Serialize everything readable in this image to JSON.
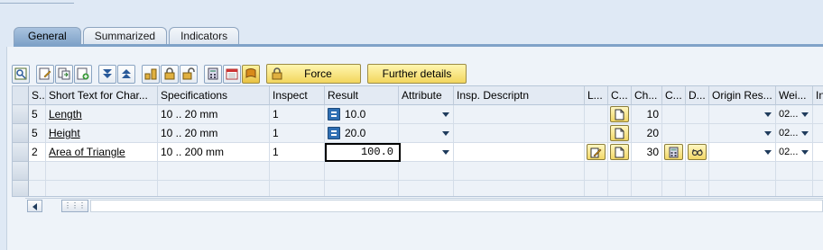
{
  "tabs": [
    {
      "label": "General",
      "active": true
    },
    {
      "label": "Summarized",
      "active": false
    },
    {
      "label": "Indicators",
      "active": false
    }
  ],
  "toolbar": {
    "icons": [
      "detail-icon",
      "edit-icon",
      "copy-icon",
      "insert-icon",
      "expand-icon",
      "collapse-icon",
      "sort-icon",
      "lock-icon",
      "unlock-icon",
      "calculator-icon",
      "calendar-icon",
      "print-icon"
    ],
    "force_label": "Force",
    "further_details_label": "Further details"
  },
  "table": {
    "columns": [
      "S...",
      "Short Text for Char...",
      "Specifications",
      "Inspect",
      "Result",
      "Attribute",
      "Insp. Descriptn",
      "L...",
      "C...",
      "Ch...",
      "C...",
      "D...",
      "Origin Res...",
      "Wei...",
      "In"
    ],
    "rows": [
      {
        "status": "5",
        "short_text": "Length",
        "spec": "10 .. 20 mm",
        "inspect": "1",
        "result": "10.0",
        "chars": "10",
        "weight": "02..."
      },
      {
        "status": "5",
        "short_text": "Height",
        "spec": "10 .. 20 mm",
        "inspect": "1",
        "result": "20.0",
        "chars": "20",
        "weight": "02..."
      },
      {
        "status": "2",
        "short_text": "Area of Triangle",
        "spec": "10 .. 200 mm",
        "inspect": "1",
        "result": "100.0",
        "chars": "30",
        "weight": "02..."
      }
    ]
  },
  "colors": {
    "accent": "#7fa2c8",
    "button_yellow": "#f2d65e",
    "result_icon": "#2f6fb3"
  }
}
